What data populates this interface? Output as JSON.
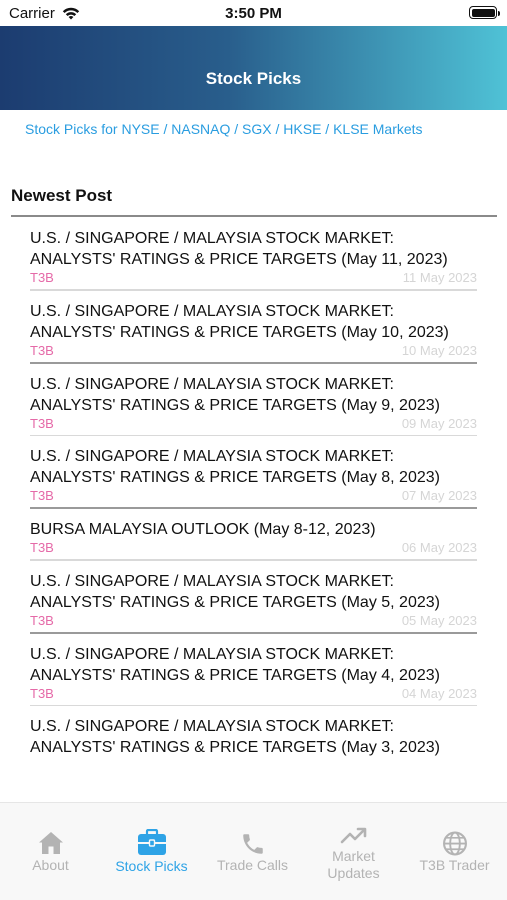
{
  "status": {
    "carrier": "Carrier",
    "time": "3:50 PM"
  },
  "header": {
    "title": "Stock Picks"
  },
  "subtitle": "Stock Picks for NYSE / NASNAQ / SGX / HKSE / KLSE Markets",
  "section": {
    "title": "Newest Post"
  },
  "posts": [
    {
      "line1": "U.S. / SINGAPORE / MALAYSIA STOCK MARKET:",
      "line2": "ANALYSTS' RATINGS & PRICE TARGETS (May 11, 2023)",
      "author": "T3B",
      "date": "11 May 2023"
    },
    {
      "line1": "U.S. / SINGAPORE / MALAYSIA STOCK MARKET:",
      "line2": "ANALYSTS' RATINGS & PRICE TARGETS (May 10, 2023)",
      "author": "T3B",
      "date": "10 May 2023"
    },
    {
      "line1": "U.S. / SINGAPORE / MALAYSIA STOCK MARKET:",
      "line2": "ANALYSTS' RATINGS & PRICE TARGETS (May 9, 2023)",
      "author": "T3B",
      "date": "09 May 2023"
    },
    {
      "line1": "U.S. / SINGAPORE / MALAYSIA STOCK MARKET:",
      "line2": "ANALYSTS' RATINGS & PRICE TARGETS (May 8, 2023)",
      "author": "T3B",
      "date": "07 May 2023"
    },
    {
      "line1": "BURSA MALAYSIA OUTLOOK (May 8-12, 2023)",
      "line2": "",
      "author": "T3B",
      "date": "06 May 2023"
    },
    {
      "line1": "U.S. / SINGAPORE / MALAYSIA STOCK MARKET:",
      "line2": "ANALYSTS' RATINGS & PRICE TARGETS (May 5, 2023)",
      "author": "T3B",
      "date": "05 May 2023"
    },
    {
      "line1": "U.S. / SINGAPORE / MALAYSIA STOCK MARKET:",
      "line2": "ANALYSTS' RATINGS & PRICE TARGETS (May 4, 2023)",
      "author": "T3B",
      "date": "04 May 2023"
    },
    {
      "line1": "U.S. / SINGAPORE / MALAYSIA STOCK MARKET:",
      "line2": "ANALYSTS' RATINGS & PRICE TARGETS (May 3, 2023)",
      "author": "",
      "date": ""
    }
  ],
  "tabs": [
    {
      "label": "About",
      "icon": "home-icon"
    },
    {
      "label": "Stock Picks",
      "icon": "briefcase-icon",
      "active": true
    },
    {
      "label": "Trade Calls",
      "icon": "phone-icon"
    },
    {
      "label": "Market\nUpdates",
      "icon": "trending-up-icon"
    },
    {
      "label": "T3B Trader",
      "icon": "globe-icon"
    }
  ],
  "colors": {
    "accent": "#2ea3e6",
    "author": "#e56aa8",
    "header_start": "#1c3c70",
    "header_end": "#4fc2d6"
  }
}
